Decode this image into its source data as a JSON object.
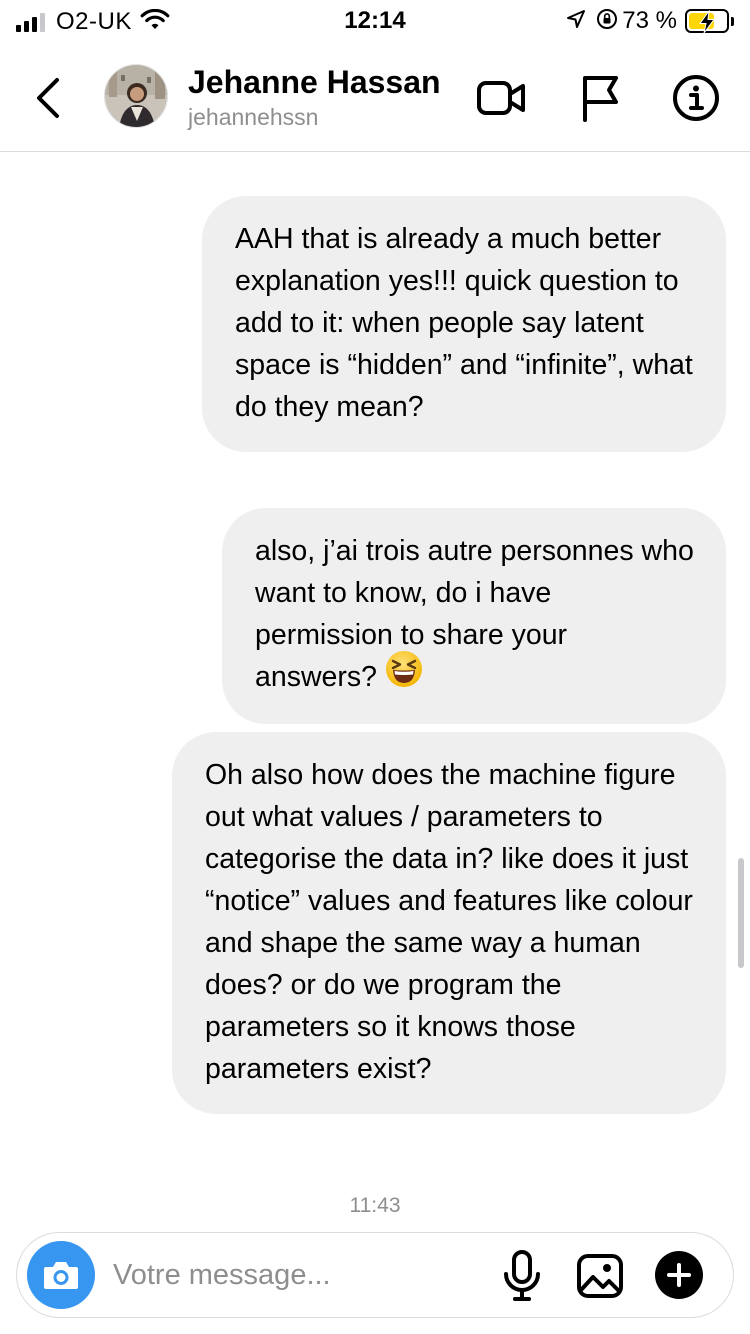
{
  "status_bar": {
    "carrier": "O2-UK",
    "time": "12:14",
    "battery_percent": "73 %",
    "signal_bars_active": 3,
    "icons": [
      "signal-icon",
      "wifi-icon",
      "location-arrow-icon",
      "orientation-lock-icon",
      "battery-charging-icon"
    ]
  },
  "header": {
    "contact_name": "Jehanne Hassan",
    "contact_username": "jehannehssn",
    "icons": [
      "back-chevron-icon",
      "video-call-icon",
      "flag-icon",
      "info-icon"
    ]
  },
  "messages": [
    {
      "sender": "me",
      "text": "AAH that is already a much better explanation yes!!! quick question to add to it: when people say latent space is “hidden” and “infinite”, what do they mean?"
    },
    {
      "sender": "me",
      "text": "also, j’ai trois autre personnes who want to know, do i have permission to share your answers?",
      "emoji": "grinning-squinting-face-icon"
    },
    {
      "sender": "me",
      "text": "Oh also how does the machine figure out what values / parameters to categorise the data in? like does it just “notice” values and features like colour and shape the same way a human does? or do we program the parameters so it knows those parameters exist?"
    }
  ],
  "timestamp": "11:43",
  "composer": {
    "placeholder": "Votre message...",
    "icons": [
      "camera-icon",
      "microphone-icon",
      "image-icon",
      "plus-icon"
    ]
  },
  "colors": {
    "bubble_background": "#efefef",
    "camera_button": "#3797f0",
    "secondary_text": "#8e8e8e",
    "battery_fill": "#ffd60a",
    "divider": "#dbdbdb"
  }
}
